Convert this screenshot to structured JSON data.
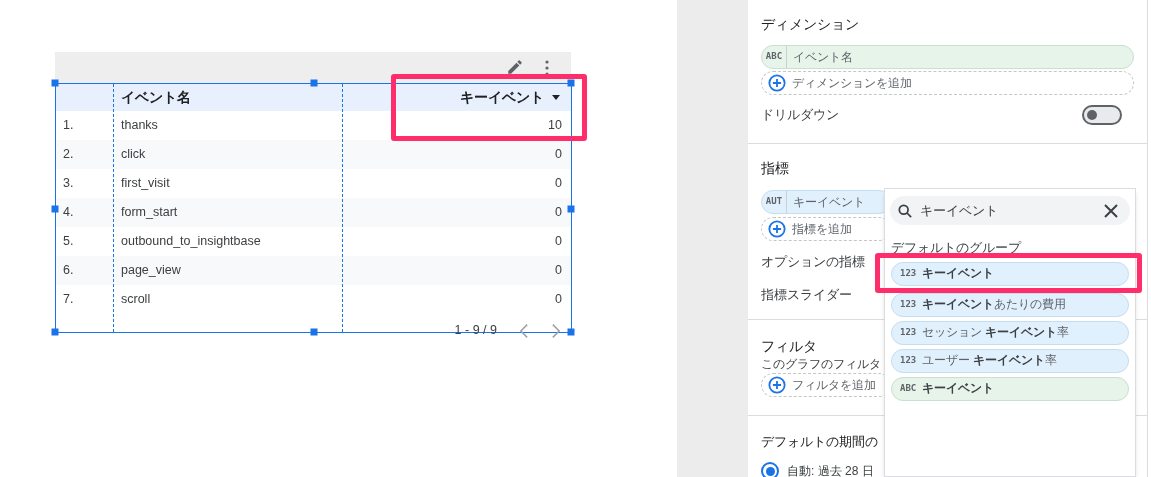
{
  "table": {
    "columns": [
      "イベント名",
      "キーイベント"
    ],
    "rows": [
      {
        "index": "1.",
        "name": "thanks",
        "value": "10"
      },
      {
        "index": "2.",
        "name": "click",
        "value": "0"
      },
      {
        "index": "3.",
        "name": "first_visit",
        "value": "0"
      },
      {
        "index": "4.",
        "name": "form_start",
        "value": "0"
      },
      {
        "index": "5.",
        "name": "outbound_to_insightbase",
        "value": "0"
      },
      {
        "index": "6.",
        "name": "page_view",
        "value": "0"
      },
      {
        "index": "7.",
        "name": "scroll",
        "value": "0"
      }
    ],
    "pagination": "1 - 9 / 9"
  },
  "panel": {
    "dimension": {
      "title": "ディメンション",
      "chip": {
        "type": "ABC",
        "label": "イベント名"
      },
      "add": "ディメンションを追加",
      "drilldown": {
        "label": "ドリルダウン",
        "on": false
      }
    },
    "metric": {
      "title": "指標",
      "chip": {
        "type": "AUT",
        "label": "キーイベント"
      },
      "add": "指標を追加",
      "optional": "オプションの指標",
      "slider": "指標スライダー"
    },
    "filter": {
      "title": "フィルタ",
      "subtitle": "このグラフのフィルタ",
      "add": "フィルタを追加"
    },
    "date": {
      "title": "デフォルトの期間の",
      "option": {
        "label": "自動: 過去 28 日",
        "selected": true
      }
    }
  },
  "dropdown": {
    "search": {
      "value": "キーイベント"
    },
    "group": "デフォルトのグループ",
    "items": [
      {
        "kind": "number",
        "type": "123",
        "label": "**キーイベント**"
      },
      {
        "kind": "number",
        "type": "123",
        "label": "**キーイベント**あたりの費用"
      },
      {
        "kind": "number",
        "type": "123",
        "label": "セッション **キーイベント**率"
      },
      {
        "kind": "number",
        "type": "123",
        "label": "ユーザー **キーイベント**率"
      },
      {
        "kind": "text",
        "type": "ABC",
        "label": "**キーイベント**"
      }
    ]
  }
}
